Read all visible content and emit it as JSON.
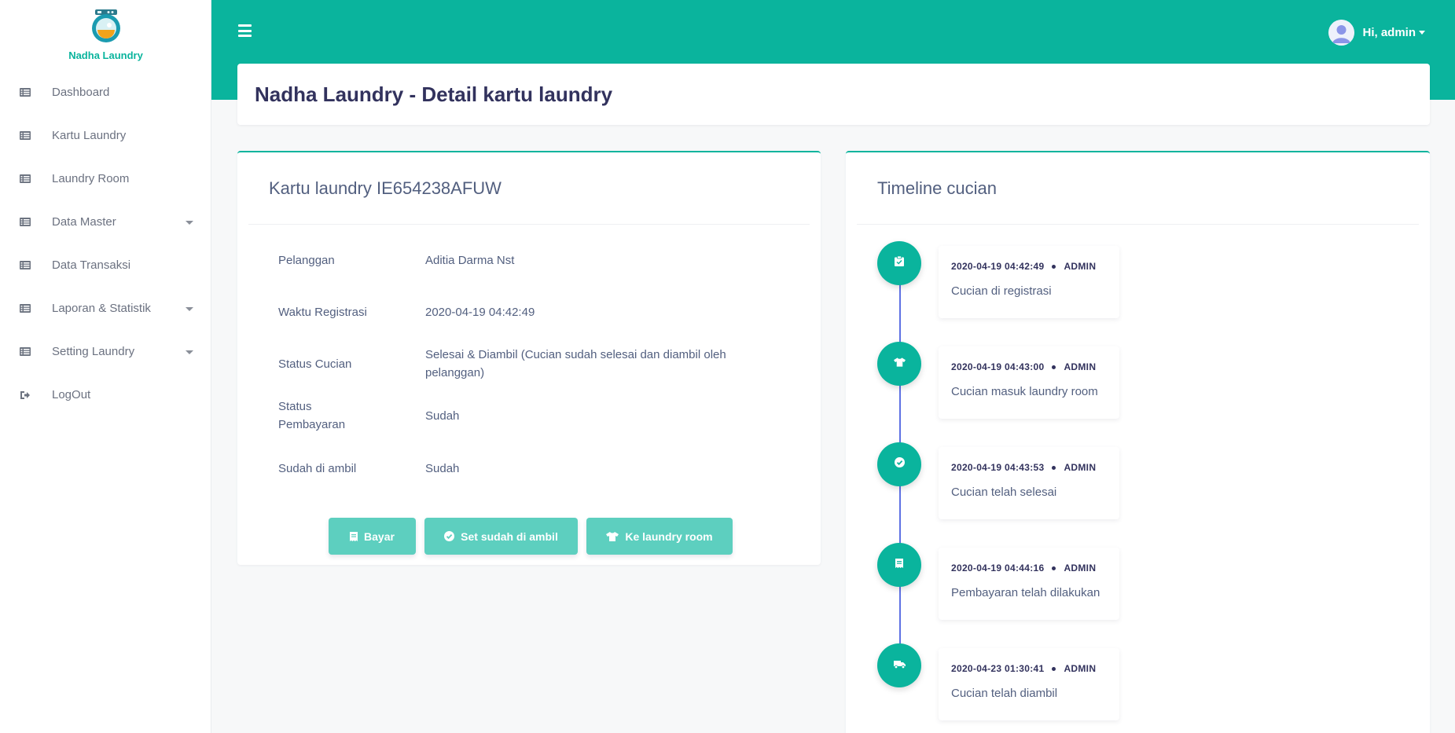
{
  "brand": {
    "name": "Nadha Laundry"
  },
  "sidebar": {
    "items": [
      {
        "label": "Dashboard",
        "icon": "list-icon",
        "has_caret": false
      },
      {
        "label": "Kartu Laundry",
        "icon": "list-icon",
        "has_caret": false
      },
      {
        "label": "Laundry Room",
        "icon": "list-icon",
        "has_caret": false
      },
      {
        "label": "Data Master",
        "icon": "list-icon",
        "has_caret": true
      },
      {
        "label": "Data Transaksi",
        "icon": "list-icon",
        "has_caret": false
      },
      {
        "label": "Laporan & Statistik",
        "icon": "list-icon",
        "has_caret": true
      },
      {
        "label": "Setting Laundry",
        "icon": "list-icon",
        "has_caret": true
      },
      {
        "label": "LogOut",
        "icon": "sign-out-icon",
        "has_caret": false
      }
    ]
  },
  "header": {
    "user_label": "Hi, admin"
  },
  "page": {
    "title": "Nadha Laundry - Detail kartu laundry"
  },
  "detail": {
    "heading": "Kartu laundry IE654238AFUW",
    "rows": [
      {
        "label": "Pelanggan",
        "value": "Aditia Darma Nst"
      },
      {
        "label": "Waktu Registrasi",
        "value": "2020-04-19 04:42:49"
      },
      {
        "label": "Status Cucian",
        "value": "Selesai & Diambil (Cucian sudah selesai dan diambil oleh pelanggan)"
      },
      {
        "label": "Status Pembayaran",
        "value": "Sudah"
      },
      {
        "label": "Sudah di ambil",
        "value": "Sudah"
      }
    ],
    "buttons": {
      "bayar": "Bayar",
      "set_diambil": "Set sudah di ambil",
      "ke_laundry_room": "Ke laundry room"
    }
  },
  "timeline": {
    "heading": "Timeline cucian",
    "events": [
      {
        "time": "2020-04-19 04:42:49",
        "user": "ADMIN",
        "text": "Cucian di registrasi",
        "icon": "clipboard-check-icon"
      },
      {
        "time": "2020-04-19 04:43:00",
        "user": "ADMIN",
        "text": "Cucian masuk laundry room",
        "icon": "shirt-icon"
      },
      {
        "time": "2020-04-19 04:43:53",
        "user": "ADMIN",
        "text": "Cucian telah selesai",
        "icon": "check-circle-icon"
      },
      {
        "time": "2020-04-19 04:44:16",
        "user": "ADMIN",
        "text": "Pembayaran telah dilakukan",
        "icon": "receipt-icon"
      },
      {
        "time": "2020-04-23 01:30:41",
        "user": "ADMIN",
        "text": "Cucian telah diambil",
        "icon": "truck-icon"
      }
    ]
  },
  "colors": {
    "primary": "#0ab49d",
    "button": "#5dcfbf",
    "timeline_line": "#5e72e4",
    "heading": "#32325d"
  }
}
